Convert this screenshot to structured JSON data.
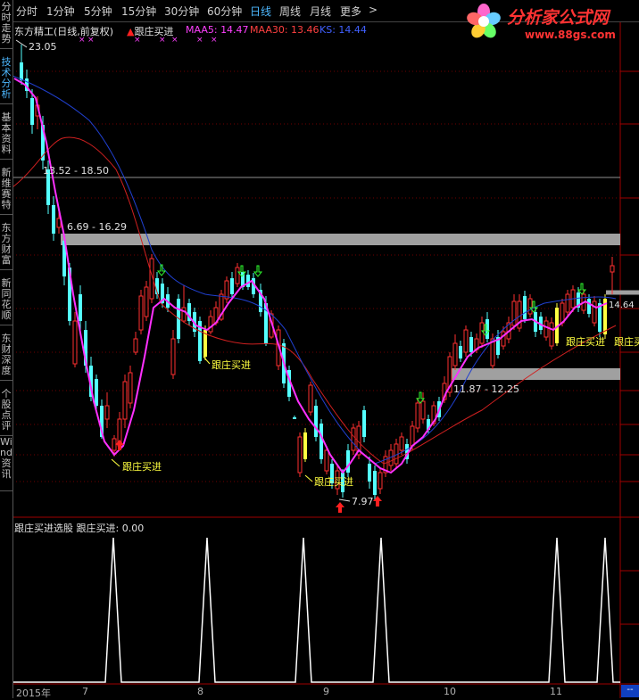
{
  "toolbar": {
    "tabs": [
      "分时",
      "1分钟",
      "5分钟",
      "15分钟",
      "30分钟",
      "60分钟",
      "日线",
      "周线",
      "月线",
      "更多"
    ],
    "active_tab": "日线",
    "more_arrow": ">"
  },
  "sidebar": {
    "items": [
      "分时走势",
      "技术分析",
      "基本资料",
      "新维赛特",
      "东方财富",
      "新同花顺",
      "东财深度",
      "个股点评",
      "Wind资讯"
    ],
    "active_item": "技术分析"
  },
  "logo": {
    "title": "分析家公式网",
    "url": "www.88gs.com"
  },
  "main_chart": {
    "title": "东方精工(日线,前复权)",
    "signal_label": "跟庄买进",
    "indicators": [
      {
        "name": "MAA5",
        "value": "14.47",
        "color": "#ff40ff"
      },
      {
        "name": "MAA30",
        "value": "13.46",
        "color": "#ff4040"
      },
      {
        "name": "KS",
        "value": "14.44",
        "color": "#4060ff"
      }
    ],
    "price_high": "23.05",
    "price_low": "7.97",
    "last_price": "14.64",
    "zones": [
      "13.52 - 18.50",
      "6.69 - 16.29",
      "11.87 - 12.25"
    ],
    "buy_labels": [
      "跟庄买进",
      "跟庄买进",
      "跟庄买进",
      "跟庄买进",
      "跟庄买进"
    ]
  },
  "sub_chart": {
    "title": "跟庄买进选股",
    "value_label": "跟庄买进:",
    "value": "0.00"
  },
  "x_axis": {
    "labels": [
      "2015年",
      "7",
      "8",
      "9",
      "10",
      "11"
    ]
  },
  "corner": "--",
  "colors": {
    "up": "#ff3030",
    "down": "#54ffff",
    "ma5": "#ff40ff",
    "ma30": "#e02020",
    "ks": "#3050ff",
    "zone": "#a0a0a0",
    "signal": "#ffff40"
  }
}
